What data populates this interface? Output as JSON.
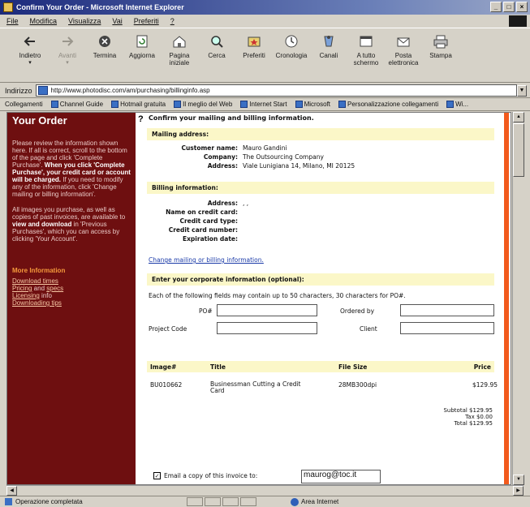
{
  "window": {
    "title": "Confirm Your Order - Microsoft Internet Explorer"
  },
  "menu": [
    "File",
    "Modifica",
    "Visualizza",
    "Vai",
    "Preferiti",
    "?"
  ],
  "toolbar": [
    {
      "label": "Indietro",
      "icon": "back-arrow-icon",
      "dim": false,
      "drop": true
    },
    {
      "label": "Avanti",
      "icon": "forward-arrow-icon",
      "dim": true,
      "drop": true
    },
    {
      "label": "Termina",
      "icon": "stop-icon",
      "dim": false,
      "drop": false
    },
    {
      "label": "Aggiorna",
      "icon": "refresh-icon",
      "dim": false,
      "drop": false
    },
    {
      "label": "Pagina iniziale",
      "icon": "home-icon",
      "dim": false,
      "drop": false
    },
    {
      "label": "Cerca",
      "icon": "search-icon",
      "dim": false,
      "drop": false
    },
    {
      "label": "Preferiti",
      "icon": "favorites-icon",
      "dim": false,
      "drop": false
    },
    {
      "label": "Cronologia",
      "icon": "history-icon",
      "dim": false,
      "drop": false
    },
    {
      "label": "Canali",
      "icon": "channels-icon",
      "dim": false,
      "drop": false
    },
    {
      "label": "A tutto schermo",
      "icon": "fullscreen-icon",
      "dim": false,
      "drop": false
    },
    {
      "label": "Posta elettronica",
      "icon": "mail-icon",
      "dim": false,
      "drop": false
    },
    {
      "label": "Stampa",
      "icon": "print-icon",
      "dim": false,
      "drop": false
    }
  ],
  "address": {
    "label": "Indirizzo",
    "url": "http://www.photodisc.com/am/purchasing/billinginfo.asp"
  },
  "links": {
    "label": "Collegamenti",
    "items": [
      "Channel Guide",
      "Hotmail gratuita",
      "Il meglio del Web",
      "Internet Start",
      "Microsoft",
      "Personalizzazione collegamenti",
      "Wi..."
    ]
  },
  "sidebar": {
    "heading": "Your Order",
    "para1a": "Please review the information shown here. If all is correct, scroll to the bottom of the page and click 'Complete Purchase'.",
    "para1b": "When you click 'Complete Purchase', your credit card or account will be charged.",
    "para1c": "If you need to modify any of the information, click 'Change mailing or billing information'.",
    "para2a": "All images you purchase, as well as copies of past invoices, are available to",
    "para2b": "view and download",
    "para2c": "in 'Previous Purchases', which you can access by clicking 'Your Account'.",
    "more_heading": "More Information",
    "link1": "Download times",
    "pricing_link": "Pricing",
    "pricing_and": " and ",
    "specs_link": "specs",
    "licensing_link": "Licensing",
    "licensing_info": " info",
    "link4": "Downloading tips"
  },
  "main": {
    "help_mark": "?",
    "title": "Confirm your mailing and billing information.",
    "mailing_heading": "Mailing address:",
    "mailing": [
      {
        "key": "Customer name:",
        "value": "Mauro   Gandini"
      },
      {
        "key": "Company:",
        "value": "The Outsourcing Company"
      },
      {
        "key": "Address:",
        "value": "Viale Lunigiana 14,   Milano, MI   20125"
      }
    ],
    "billing_heading": "Billing information:",
    "billing": [
      {
        "key": "Address:",
        "value": ",  ,"
      },
      {
        "key": "Name on credit card:",
        "value": ""
      },
      {
        "key": "Credit card type:",
        "value": ""
      },
      {
        "key": "Credit card number:",
        "value": ""
      },
      {
        "key": "Expiration date:",
        "value": ""
      }
    ],
    "change_link": "Change mailing or billing information.",
    "corporate_heading": "Enter your corporate information (optional):",
    "instruction": "Each of the following fields may contain up to 50 characters, 30 characters for PO#.",
    "po_label": "PO#",
    "ordered_by_label": "Ordered by",
    "project_label": "Project Code",
    "client_label": "Client",
    "table_headers": {
      "image": "Image#",
      "title": "Title",
      "size": "File Size",
      "price": "Price"
    },
    "items": [
      {
        "image": "BU010662",
        "title": "Businessman Cutting a Credit Card",
        "size": "28MB300dpi",
        "price": "$129.95"
      }
    ],
    "subtotal": "Subtotal $129.95",
    "tax": "Tax   $0.00",
    "total": "Total $129.95",
    "email_label": "Email a copy of this invoice to:",
    "email_value": "maurog@toc.it",
    "email_checked": true
  },
  "status": {
    "text": "Operazione completata",
    "zone": "Area Internet"
  },
  "colors": {
    "sidebar_bg": "#6e0f10",
    "accent_orange": "#f25a1c",
    "band_yellow": "#fbf7c8",
    "link_blue": "#1a3aa8"
  }
}
